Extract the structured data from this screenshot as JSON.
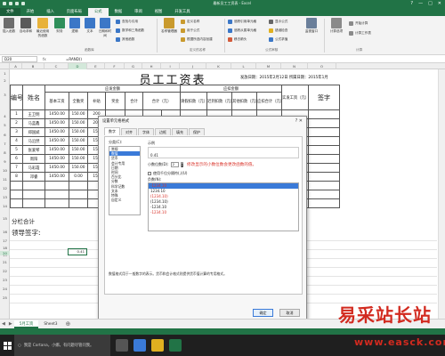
{
  "window": {
    "title": "最新员工工资表 - Excel",
    "controls": [
      "?",
      "—",
      "□",
      "✕"
    ]
  },
  "ribbon": {
    "tabs": [
      "文件",
      "开始",
      "插入",
      "页面布局",
      "公式",
      "数据",
      "审阅",
      "视图",
      "开发工具"
    ],
    "active_tab": "公式",
    "buttons": {
      "insert_fn": "插入函数",
      "autosum": "自动求和",
      "recent": "最近使用的函数",
      "financial": "财务",
      "logical": "逻辑",
      "text": "文本",
      "datetime": "日期和时间",
      "lookup": "查找与引用",
      "math": "数学和三角函数",
      "more": "其他函数",
      "name_mgr": "名称管理器",
      "define_name": "定义名称",
      "use_in_formula": "用于公式",
      "create_from_sel": "根据所选内容创建",
      "trace_prec": "追踪引用单元格",
      "trace_dep": "追踪从属单元格",
      "remove_arrows": "移去箭头",
      "show_formulas": "显示公式",
      "error_check": "错误检查",
      "evaluate": "公式求值",
      "watch": "监视窗口",
      "calc_options": "计算选项",
      "calc_now": "开始计算",
      "calc_sheet": "计算工作表"
    },
    "groups": {
      "library": "函数库",
      "names": "定义的名称",
      "auditing": "公式审核",
      "calculation": "计算"
    }
  },
  "formula_bar": {
    "name_box": "D20",
    "fx": "fx",
    "value": "=RAND()"
  },
  "sheet": {
    "title": "员工工资表",
    "date_info": "发放日期：2015年2月12日  所属日期：2015年1月",
    "headers": {
      "no": "编号",
      "name": "姓名",
      "payable": "应发金额",
      "base": "基本工资",
      "bonus": "全勤奖",
      "subsidy": "补贴",
      "overtime": "奖金",
      "other": "合计",
      "total": "合计（元）",
      "deduct": "应扣金额",
      "late": "请假扣款（元）",
      "insurance": "迟到扣款（元）",
      "social": "其他扣款（元）",
      "deduct_total": "应扣合计（元）",
      "actual": "实发工资（元）",
      "sign": "签字"
    },
    "rows": [
      {
        "no": "1",
        "name": "王卫明",
        "base": "1450.00",
        "bonus": "150.00",
        "sub": "200"
      },
      {
        "no": "2",
        "name": "马蓝鑫",
        "base": "1450.00",
        "bonus": "150.00",
        "sub": "200"
      },
      {
        "no": "3",
        "name": "郑国斌",
        "base": "1450.00",
        "bonus": "150.00",
        "sub": "150"
      },
      {
        "no": "4",
        "name": "马沿然",
        "base": "1450.00",
        "bonus": "150.00",
        "sub": "150"
      },
      {
        "no": "5",
        "name": "张爱琴",
        "base": "1450.00",
        "bonus": "150.00",
        "sub": "150"
      },
      {
        "no": "6",
        "name": "周阳",
        "base": "1450.00",
        "bonus": "150.00",
        "sub": "150"
      },
      {
        "no": "7",
        "name": "马彩霞",
        "base": "1450.00",
        "bonus": "150.00",
        "sub": "150"
      },
      {
        "no": "8",
        "name": "邓睿",
        "base": "1450.00",
        "bonus": "0.00",
        "sub": "150"
      }
    ],
    "subtotal": "分栏合计",
    "leader": "领导签字:",
    "selected_cell_value": "0.41"
  },
  "columns": [
    "A",
    "B",
    "C",
    "D",
    "E",
    "F",
    "G",
    "H",
    "I",
    "J",
    "K",
    "L",
    "M",
    "N",
    "O"
  ],
  "row_numbers": [
    "1",
    "2",
    "3",
    "4",
    "5",
    "6",
    "7",
    "8",
    "9",
    "10",
    "11",
    "12",
    "13",
    "14",
    "15",
    "16",
    "17",
    "18",
    "19",
    "20",
    "21",
    "22",
    "23",
    "24",
    "25"
  ],
  "dialog": {
    "title": "设置单元格格式",
    "close": "?  ✕",
    "tabs": [
      "数字",
      "对齐",
      "字体",
      "边框",
      "填充",
      "保护"
    ],
    "active_tab": "数字",
    "category_label": "分类(C):",
    "categories": [
      "常规",
      "数值",
      "货币",
      "会计专用",
      "日期",
      "时间",
      "百分比",
      "分数",
      "科学记数",
      "文本",
      "特殊",
      "自定义"
    ],
    "selected_category": "数值",
    "sample_label": "示例",
    "sample_value": "0.41",
    "decimals_label": "小数位数(D):",
    "decimals_value": "2",
    "note": "修改显示的小数位数会更改函数的值。",
    "thousands_label": "使用千位分隔符(,)(U)",
    "negative_label": "负数(N):",
    "negatives": [
      "-1234.10",
      "1234.10",
      "(1234.10)",
      "(1234.10)",
      "-1234.10",
      "-1234.10"
    ],
    "description": "数值格式用于一般数字的表示。货币和会计格式则提供货币值计算的专用格式。",
    "ok": "确定",
    "cancel": "取消"
  },
  "sheet_tabs": [
    "5月工资",
    "Sheet3"
  ],
  "active_sheet": "5月工资",
  "taskbar": {
    "search": "我是 Cortana，小娜。有问题尽管问我。"
  },
  "watermark": {
    "text1": "易采站长站",
    "text2": "www.easck.com"
  },
  "colors": {
    "excel_green": "#217346",
    "note_red": "#d9342b",
    "selection_blue": "#3a7ad8"
  }
}
